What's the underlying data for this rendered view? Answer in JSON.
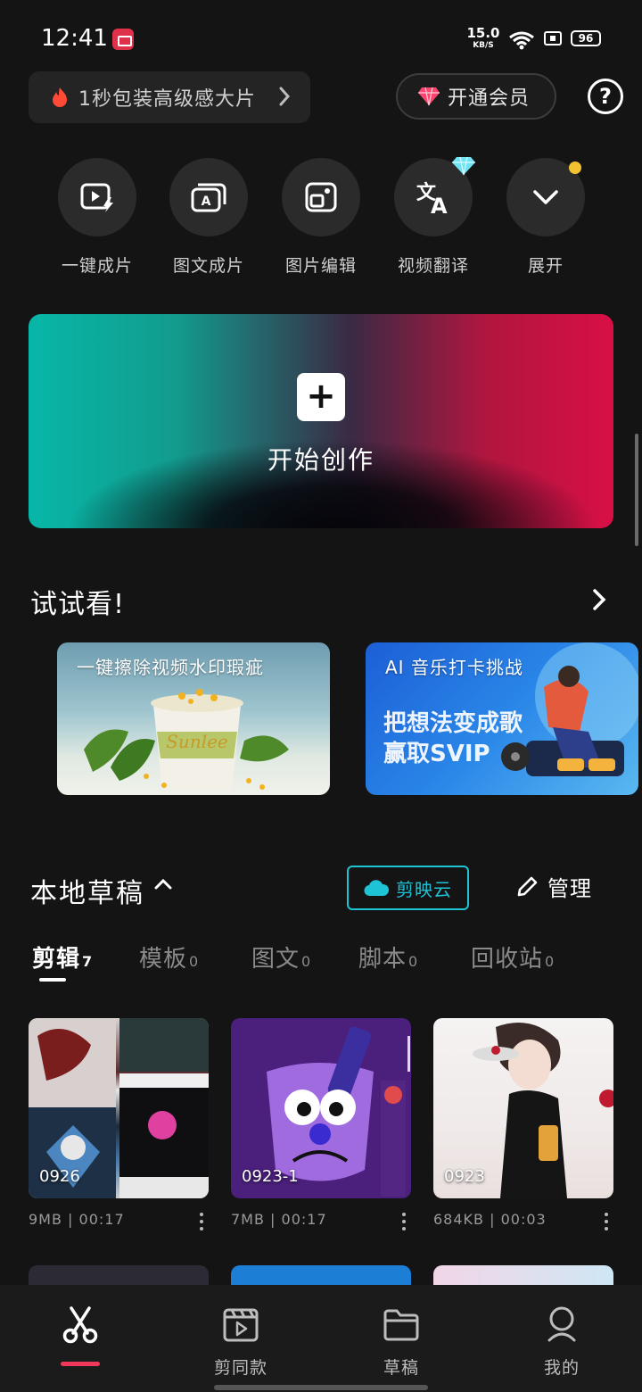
{
  "status_bar": {
    "time": "12:41",
    "net_speed": "15.0",
    "net_unit": "KB/S",
    "battery": "96"
  },
  "header": {
    "promo_text": "1秒包装高级感大片",
    "vip_label": "开通会员"
  },
  "tools": [
    {
      "label": "一键成片",
      "icon": "auto-clip-icon"
    },
    {
      "label": "图文成片",
      "icon": "text-to-video-icon"
    },
    {
      "label": "图片编辑",
      "icon": "image-edit-icon"
    },
    {
      "label": "视频翻译",
      "icon": "translate-icon"
    },
    {
      "label": "展开",
      "icon": "expand-icon"
    }
  ],
  "create": {
    "label": "开始创作"
  },
  "try": {
    "title": "试试看!",
    "cards": [
      {
        "caption": "一键擦除视频水印瑕疵",
        "cup_text": "Sunlee"
      },
      {
        "caption": "AI 音乐打卡挑战",
        "line1": "把想法变成歌",
        "line2": "赢取SVIP"
      }
    ]
  },
  "drafts": {
    "title": "本地草稿",
    "cloud_label": "剪映云",
    "manage_label": "管理",
    "tabs": [
      {
        "label": "剪辑",
        "count": "7"
      },
      {
        "label": "模板",
        "count": "0"
      },
      {
        "label": "图文",
        "count": "0"
      },
      {
        "label": "脚本",
        "count": "0"
      },
      {
        "label": "回收站",
        "count": "0"
      }
    ],
    "items": [
      {
        "name": "0926",
        "size": "9MB",
        "duration": "00:17"
      },
      {
        "name": "0923-1",
        "size": "7MB",
        "duration": "00:17"
      },
      {
        "name": "0923",
        "size": "684KB",
        "duration": "00:03"
      }
    ]
  },
  "bottom_nav": [
    {
      "label": "",
      "icon": "scissors-icon"
    },
    {
      "label": "剪同款",
      "icon": "clapper-icon"
    },
    {
      "label": "草稿",
      "icon": "folder-icon"
    },
    {
      "label": "我的",
      "icon": "profile-icon"
    }
  ],
  "colors": {
    "accent_cyan": "#1fc3d6",
    "accent_red": "#f0395a",
    "background": "#141414"
  }
}
